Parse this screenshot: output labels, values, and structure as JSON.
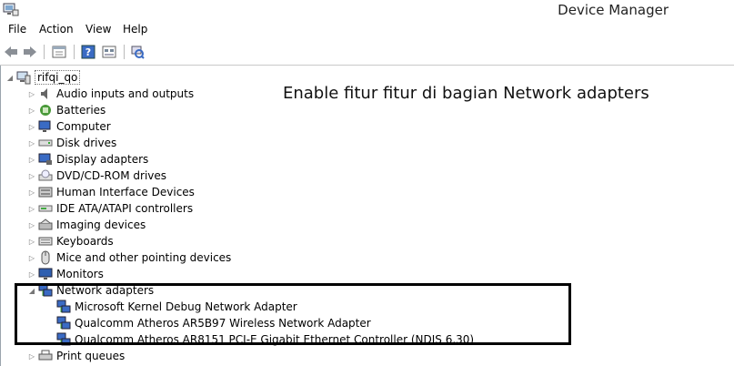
{
  "window": {
    "title": "Device Manager"
  },
  "menu": [
    "File",
    "Action",
    "View",
    "Help"
  ],
  "toolbar": {
    "buttons": [
      "back-icon",
      "forward-icon",
      "properties-icon",
      "help-icon",
      "show-hidden-icon",
      "scan-hardware-icon"
    ]
  },
  "tree": {
    "root": "rifqi_qo",
    "categories": [
      "Audio inputs and outputs",
      "Batteries",
      "Computer",
      "Disk drives",
      "Display adapters",
      "DVD/CD-ROM drives",
      "Human Interface Devices",
      "IDE ATA/ATAPI controllers",
      "Imaging devices",
      "Keyboards",
      "Mice and other pointing devices",
      "Monitors",
      "Network adapters",
      "Print queues"
    ],
    "network_children": [
      "Microsoft Kernel Debug Network Adapter",
      "Qualcomm Atheros AR5B97 Wireless Network Adapter",
      "Qualcomm Atheros AR8151 PCI-E Gigabit Ethernet Controller (NDIS 6.30)"
    ]
  },
  "annotation": "Enable fitur fitur di bagian Network adapters",
  "colors": {
    "highlight_border": "#000000",
    "tree_line": "#9aa4ad"
  }
}
